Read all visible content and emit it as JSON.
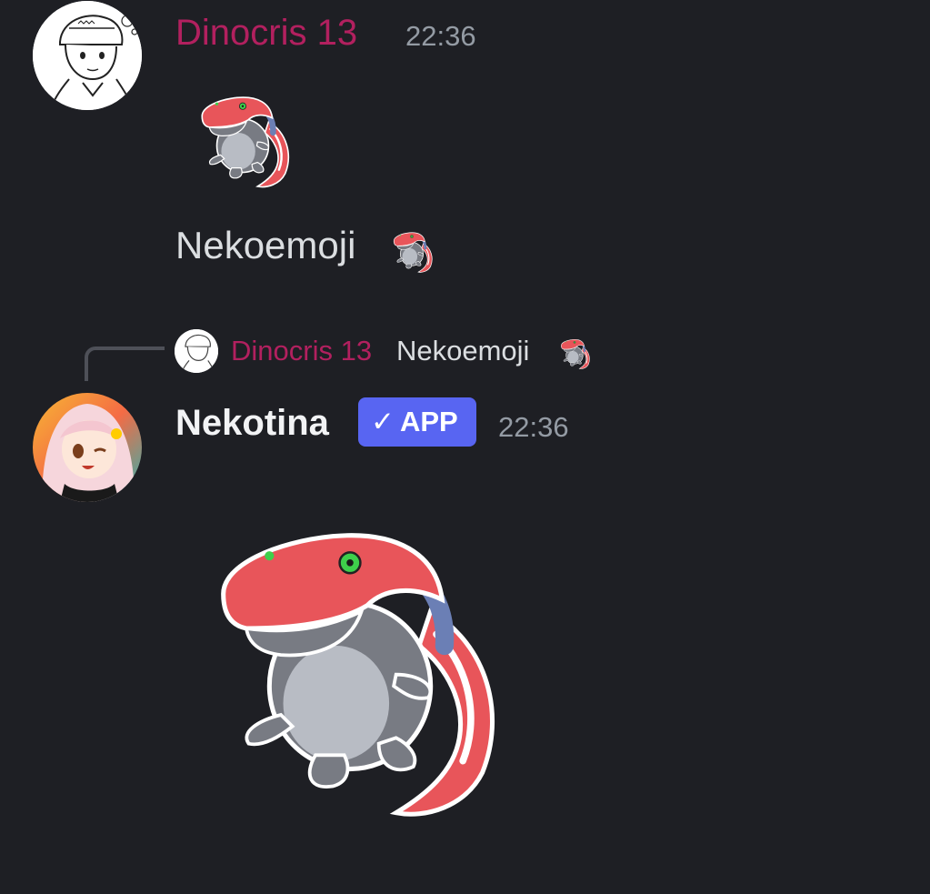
{
  "colors": {
    "background": "#1e1f24",
    "username_pink": "#b2205f",
    "username_white": "#f2f3f5",
    "timestamp": "#949ba4",
    "message_text": "#dbdee1",
    "app_badge": "#5865f2"
  },
  "messages": [
    {
      "author": "Dinocris 13",
      "timestamp": "22:36",
      "avatar_icon": "sketch-avatar-icon",
      "sticker_icon": "red-crocodile-sticker-icon",
      "text": "Nekoemoji",
      "inline_emoji_icon": "red-crocodile-emoji-icon"
    },
    {
      "reply": {
        "author": "Dinocris 13",
        "text": "Nekoemoji",
        "emoji_icon": "red-crocodile-emoji-icon"
      },
      "author": "Nekotina",
      "badge": "APP",
      "badge_check": "✓",
      "timestamp": "22:36",
      "avatar_icon": "anime-girl-avatar-icon",
      "sticker_icon": "red-crocodile-sticker-icon"
    }
  ]
}
